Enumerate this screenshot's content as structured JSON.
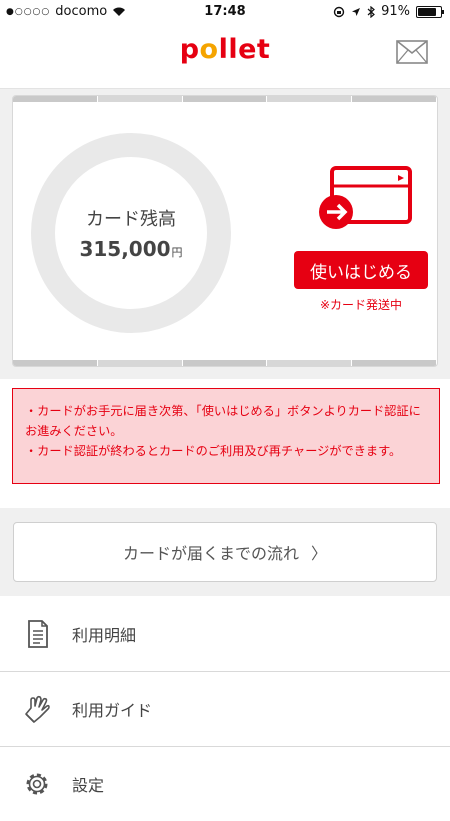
{
  "status_bar": {
    "carrier": "docomo",
    "time": "17:48",
    "battery": "91%",
    "battery_level": 0.91
  },
  "header": {
    "logo": "pollet",
    "mail_icon": "mail-icon"
  },
  "balance": {
    "label": "カード残高",
    "amount": "315,000",
    "unit": "円"
  },
  "card_action": {
    "icon": "card-arrow-icon",
    "button_label": "使いはじめる",
    "note": "※カード発送中"
  },
  "notice": {
    "line1": "・カードがお手元に届き次第、「使いはじめる」ボタンよりカード認証にお進みください。",
    "line2": "・カード認証が終わるとカードのご利用及び再チャージができます。"
  },
  "flow_link": {
    "label": "カードが届くまでの流れ",
    "chevron": "〉"
  },
  "menu": {
    "items": [
      {
        "label": "利用明細",
        "icon": "document-icon"
      },
      {
        "label": "利用ガイド",
        "icon": "glove-icon"
      },
      {
        "label": "設定",
        "icon": "gear-icon"
      }
    ]
  },
  "colors": {
    "accent": "#e60012",
    "logo_o": "#f5a400",
    "notice_bg": "#fbd3d6"
  }
}
